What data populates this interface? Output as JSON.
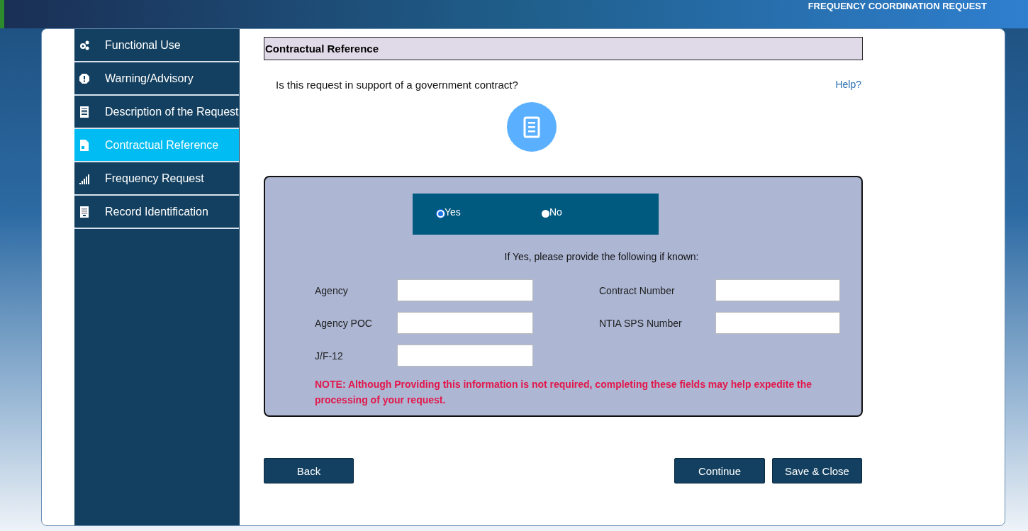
{
  "header": {
    "title": "FREQUENCY COORDINATION REQUEST"
  },
  "sidebar": {
    "items": [
      {
        "label": "Functional Use",
        "selected": false
      },
      {
        "label": "Warning/Advisory",
        "selected": false
      },
      {
        "label": "Description of the Request",
        "selected": false
      },
      {
        "label": "Contractual Reference",
        "selected": true
      },
      {
        "label": "Frequency Request",
        "selected": false
      },
      {
        "label": "Record Identification",
        "selected": false
      }
    ]
  },
  "section": {
    "title": "Contractual Reference",
    "question": "Is this request in support of a government contract?",
    "help": "Help?"
  },
  "options": [
    {
      "label": "Yes",
      "selected": true
    },
    {
      "label": "No",
      "selected": false
    }
  ],
  "hint": "If Yes, please provide the following if known:",
  "fields": [
    {
      "label": "Agency"
    },
    {
      "label": "Contract Number"
    },
    {
      "label": "Agency POC"
    },
    {
      "label": "NTIA SPS Number"
    },
    {
      "label": "J/F-12"
    }
  ],
  "note": "NOTE: Although Providing this information is not required, completing these fields may help expedite the processing of your request.",
  "buttons": {
    "back": "Back",
    "continue": "Continue",
    "save": "Save & Close"
  }
}
